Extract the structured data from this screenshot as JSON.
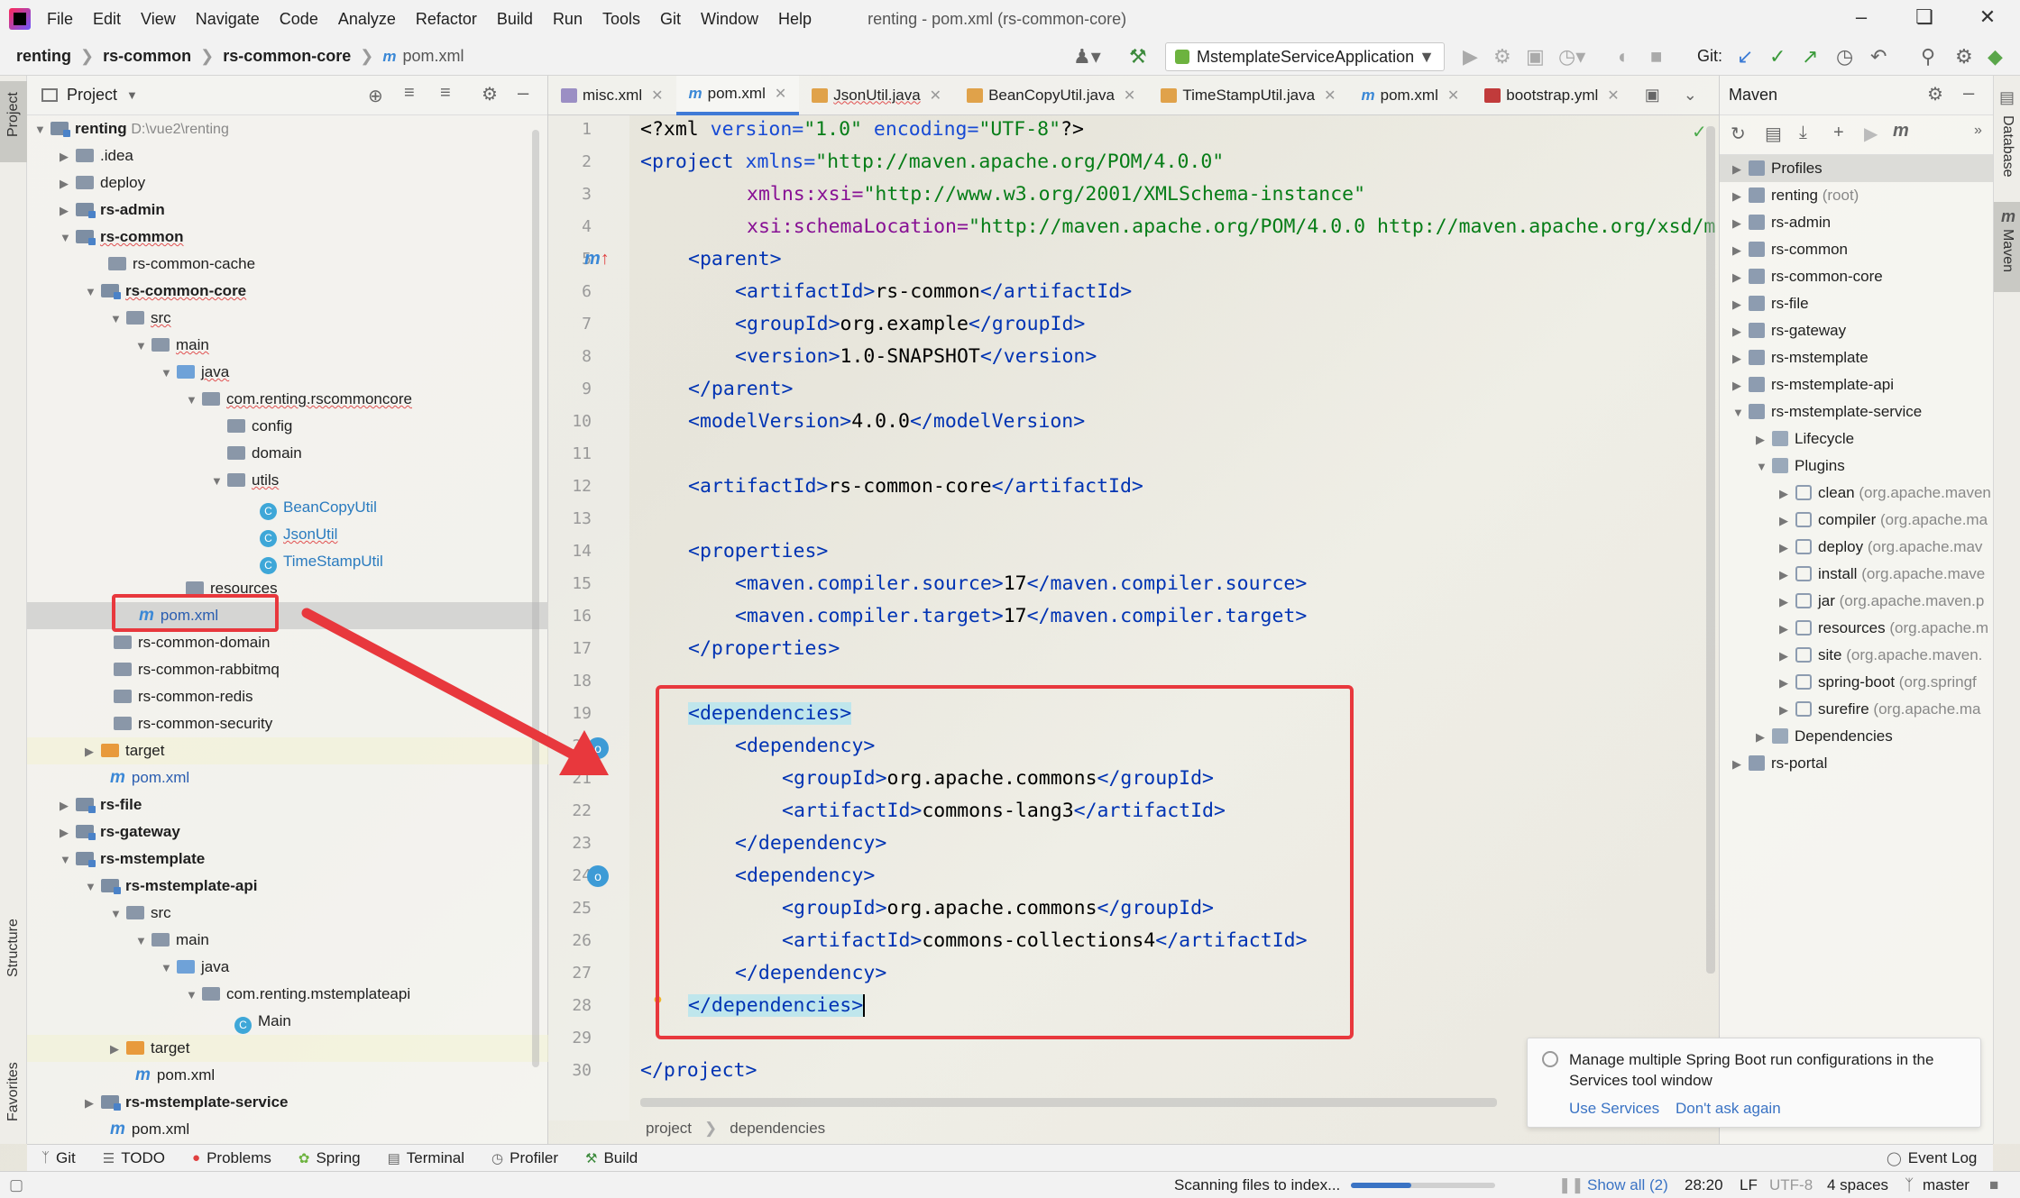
{
  "menu": {
    "items": [
      "File",
      "Edit",
      "View",
      "Navigate",
      "Code",
      "Analyze",
      "Refactor",
      "Build",
      "Run",
      "Tools",
      "Git",
      "Window",
      "Help"
    ],
    "window_title": "renting - pom.xml (rs-common-core)"
  },
  "navbar": {
    "breadcrumbs": [
      "renting",
      "rs-common",
      "rs-common-core",
      "pom.xml"
    ],
    "run_config": "MstemplateServiceApplication",
    "git_label": "Git:"
  },
  "project_panel": {
    "title": "Project",
    "root_path": "D:\\vue2\\renting",
    "rows": [
      {
        "label": "renting"
      },
      {
        "label": ".idea"
      },
      {
        "label": "deploy"
      },
      {
        "label": "rs-admin"
      },
      {
        "label": "rs-common"
      },
      {
        "label": "rs-common-cache"
      },
      {
        "label": "rs-common-core"
      },
      {
        "label": "src"
      },
      {
        "label": "main"
      },
      {
        "label": "java"
      },
      {
        "label": "com.renting.rscommoncore"
      },
      {
        "label": "config"
      },
      {
        "label": "domain"
      },
      {
        "label": "utils"
      },
      {
        "label": "BeanCopyUtil"
      },
      {
        "label": "JsonUtil"
      },
      {
        "label": "TimeStampUtil"
      },
      {
        "label": "resources"
      },
      {
        "label": "pom.xml"
      },
      {
        "label": "rs-common-domain"
      },
      {
        "label": "rs-common-rabbitmq"
      },
      {
        "label": "rs-common-redis"
      },
      {
        "label": "rs-common-security"
      },
      {
        "label": "target"
      },
      {
        "label": "pom.xml"
      },
      {
        "label": "rs-file"
      },
      {
        "label": "rs-gateway"
      },
      {
        "label": "rs-mstemplate"
      },
      {
        "label": "rs-mstemplate-api"
      },
      {
        "label": "src"
      },
      {
        "label": "main"
      },
      {
        "label": "java"
      },
      {
        "label": "com.renting.mstemplateapi"
      },
      {
        "label": "Main"
      },
      {
        "label": "target"
      },
      {
        "label": "pom.xml"
      },
      {
        "label": "rs-mstemplate-service"
      },
      {
        "label": "pom.xml"
      }
    ]
  },
  "tabs": [
    {
      "label": "misc.xml"
    },
    {
      "label": "pom.xml"
    },
    {
      "label": "JsonUtil.java"
    },
    {
      "label": "BeanCopyUtil.java"
    },
    {
      "label": "TimeStampUtil.java"
    },
    {
      "label": "pom.xml"
    },
    {
      "label": "bootstrap.yml"
    }
  ],
  "code": {
    "line_numbers": [
      "1",
      "2",
      "3",
      "4",
      "5",
      "6",
      "7",
      "8",
      "9",
      "10",
      "11",
      "12",
      "13",
      "14",
      "15",
      "16",
      "17",
      "18",
      "19",
      "20",
      "21",
      "22",
      "23",
      "24",
      "25",
      "26",
      "27",
      "28",
      "29",
      "30"
    ],
    "l1a": "<?xml ",
    "l1b": "version=",
    "l1c": "\"1.0\"",
    "l1d": " encoding=",
    "l1e": "\"UTF-8\"",
    "l1f": "?>",
    "l2a": "<project ",
    "l2b": "xmlns=",
    "l2c": "\"http://maven.apache.org/POM/4.0.0\"",
    "l3a": "xmlns:xsi=",
    "l3b": "\"http://www.w3.org/2001/XMLSchema-instance\"",
    "l4a": "xsi:schemaLocation=",
    "l4b": "\"http://maven.apache.org/POM/4.0.0 http://maven.apache.org/xsd/m",
    "parent_open": "<parent>",
    "l6": "rs-common",
    "l7": "org.example",
    "l8": "1.0-SNAPSHOT",
    "parent_close": "</parent>",
    "l10": "4.0.0",
    "l12": "rs-common-core",
    "properties_open": "<properties>",
    "l15": "17",
    "l16": "17",
    "properties_close": "</properties>",
    "deps_open": "<dependencies>",
    "dep_open": "<dependency>",
    "l22g": "org.apache.commons",
    "l23a": "commons-lang3",
    "dep_close": "</dependency>",
    "l26g": "org.apache.commons",
    "l27a": "commons-collections4",
    "deps_close": "</dependencies>",
    "project_close": "</project>",
    "t_artifactId": "artifactId",
    "t_groupId": "groupId",
    "t_version": "version",
    "t_modelVersion": "modelVersion",
    "t_src": "maven.compiler.source",
    "t_tgt": "maven.compiler.target"
  },
  "editor_breadcrumb": [
    "project",
    "dependencies"
  ],
  "maven_panel": {
    "title": "Maven",
    "rows": [
      {
        "label": "Profiles",
        "sub": ""
      },
      {
        "label": "renting",
        "sub": "(root)"
      },
      {
        "label": "rs-admin",
        "sub": ""
      },
      {
        "label": "rs-common",
        "sub": ""
      },
      {
        "label": "rs-common-core",
        "sub": ""
      },
      {
        "label": "rs-file",
        "sub": ""
      },
      {
        "label": "rs-gateway",
        "sub": ""
      },
      {
        "label": "rs-mstemplate",
        "sub": ""
      },
      {
        "label": "rs-mstemplate-api",
        "sub": ""
      },
      {
        "label": "rs-mstemplate-service",
        "sub": ""
      },
      {
        "label": "Lifecycle",
        "sub": ""
      },
      {
        "label": "Plugins",
        "sub": ""
      },
      {
        "label": "clean",
        "sub": "(org.apache.maven"
      },
      {
        "label": "compiler",
        "sub": "(org.apache.ma"
      },
      {
        "label": "deploy",
        "sub": "(org.apache.mav"
      },
      {
        "label": "install",
        "sub": "(org.apache.mave"
      },
      {
        "label": "jar",
        "sub": "(org.apache.maven.p"
      },
      {
        "label": "resources",
        "sub": "(org.apache.m"
      },
      {
        "label": "site",
        "sub": "(org.apache.maven."
      },
      {
        "label": "spring-boot",
        "sub": "(org.springf"
      },
      {
        "label": "surefire",
        "sub": "(org.apache.ma"
      },
      {
        "label": "Dependencies",
        "sub": ""
      },
      {
        "label": "rs-portal",
        "sub": ""
      }
    ]
  },
  "side_labels": {
    "project": "Project",
    "structure": "Structure",
    "favorites": "Favorites",
    "database": "Database",
    "maven": "Maven"
  },
  "bottom_tools": [
    "Git",
    "TODO",
    "Problems",
    "Spring",
    "Terminal",
    "Profiler",
    "Build"
  ],
  "event_log": "Event Log",
  "notification": {
    "text": "Manage multiple Spring Boot run configurations in the Services tool window",
    "action1": "Use Services",
    "action2": "Don't ask again"
  },
  "status": {
    "indexing": "Scanning files to index...",
    "show_all": "Show all (2)",
    "position": "28:20",
    "line_sep": "LF",
    "encoding": "UTF-8",
    "indent": "4 spaces",
    "branch": "master",
    "index_progress": 0.42
  },
  "colors": {
    "accent": "#3f7ad6",
    "highlight_box": "#e8383d",
    "tag": "#0033b3",
    "attr_value": "#067d17"
  }
}
